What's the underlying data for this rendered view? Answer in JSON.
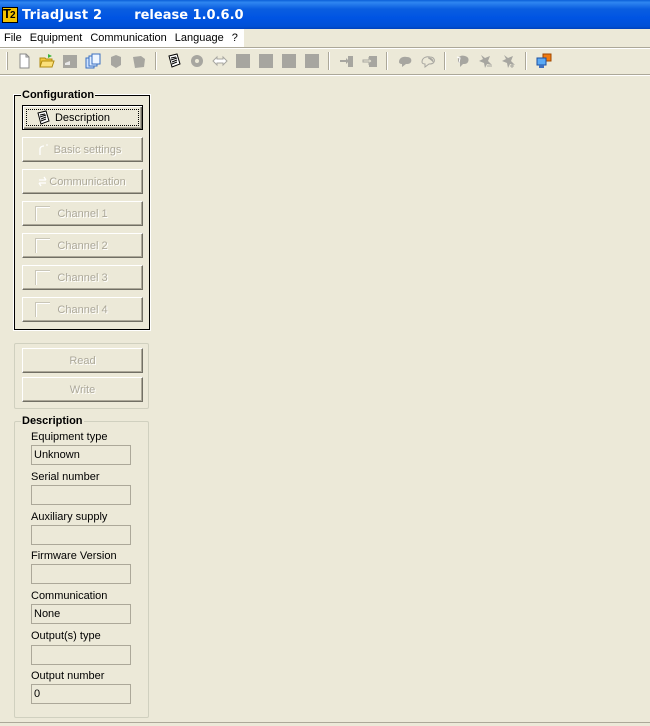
{
  "window": {
    "title": "TriadJust 2",
    "release": "release 1.0.6.0",
    "colors": {
      "titlebar": "#0054e3",
      "background": "#ece9d8",
      "disabled_text": "#aca899"
    }
  },
  "menu": {
    "items": [
      {
        "label": "File"
      },
      {
        "label": "Equipment"
      },
      {
        "label": "Communication"
      },
      {
        "label": "Language"
      },
      {
        "label": "?"
      }
    ]
  },
  "toolbar": {
    "groups": [
      [
        "new-file-icon",
        "open-folder-icon",
        "save-icon",
        "copy-icon",
        "cube-icon",
        "cube-flat-icon"
      ],
      [
        "notepad-icon",
        "gear-icon",
        "arrows-exchange-icon",
        "square-1-icon",
        "square-2-icon",
        "square-3-icon",
        "square-4-icon"
      ],
      [
        "import-icon",
        "export-icon"
      ],
      [
        "cloud-icon",
        "cloud-outline-icon"
      ],
      [
        "cloud-arrow-icon",
        "star-left-icon",
        "star-right-icon"
      ],
      [
        "network-computer-icon"
      ]
    ]
  },
  "configuration": {
    "title": "Configuration",
    "buttons": [
      {
        "label": "Description",
        "icon": "notepad-icon",
        "enabled": true,
        "focused": true
      },
      {
        "label": "Basic settings",
        "icon": "settings-icon",
        "enabled": false
      },
      {
        "label": "Communication",
        "icon": "communication-icon",
        "enabled": false
      },
      {
        "label": "Channel 1",
        "icon": "channel-icon",
        "enabled": false
      },
      {
        "label": "Channel 2",
        "icon": "channel-icon",
        "enabled": false
      },
      {
        "label": "Channel 3",
        "icon": "channel-icon",
        "enabled": false
      },
      {
        "label": "Channel 4",
        "icon": "channel-icon",
        "enabled": false
      }
    ]
  },
  "actions": {
    "read_label": "Read",
    "write_label": "Write"
  },
  "description": {
    "title": "Description",
    "fields": [
      {
        "label": "Equipment type",
        "value": "Unknown"
      },
      {
        "label": "Serial number",
        "value": ""
      },
      {
        "label": "Auxiliary supply",
        "value": ""
      },
      {
        "label": "Firmware Version",
        "value": ""
      },
      {
        "label": "Communication",
        "value": "None"
      },
      {
        "label": "Output(s) type",
        "value": ""
      },
      {
        "label": "Output number",
        "value": "0"
      }
    ]
  }
}
